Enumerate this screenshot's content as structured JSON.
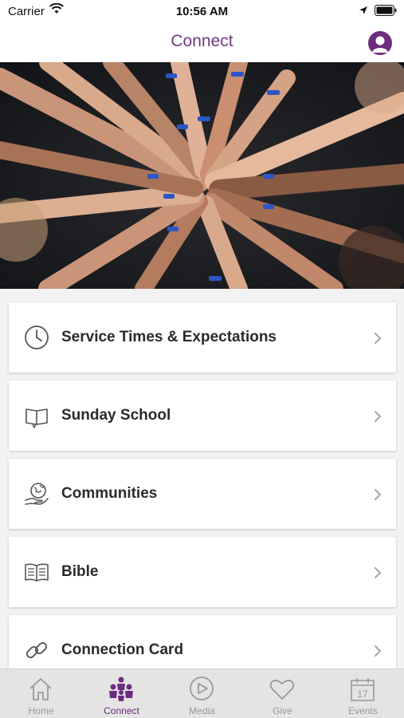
{
  "status_bar": {
    "carrier": "Carrier",
    "time": "10:56 AM"
  },
  "nav": {
    "title": "Connect"
  },
  "colors": {
    "accent": "#6e2c81",
    "title": "#6e3a7d",
    "tab_inactive": "#999999"
  },
  "menu": [
    {
      "label": "Service Times & Expectations",
      "icon": "clock-icon"
    },
    {
      "label": "Sunday School",
      "icon": "book-icon"
    },
    {
      "label": "Communities",
      "icon": "globe-hand-icon"
    },
    {
      "label": "Bible",
      "icon": "open-bible-icon"
    },
    {
      "label": "Connection Card",
      "icon": "link-icon"
    }
  ],
  "tabs": [
    {
      "label": "Home",
      "icon": "home-icon",
      "active": false
    },
    {
      "label": "Connect",
      "icon": "people-icon",
      "active": true
    },
    {
      "label": "Media",
      "icon": "play-icon",
      "active": false
    },
    {
      "label": "Give",
      "icon": "heart-icon",
      "active": false
    },
    {
      "label": "Events",
      "icon": "calendar-icon",
      "active": false,
      "day": "17"
    }
  ]
}
